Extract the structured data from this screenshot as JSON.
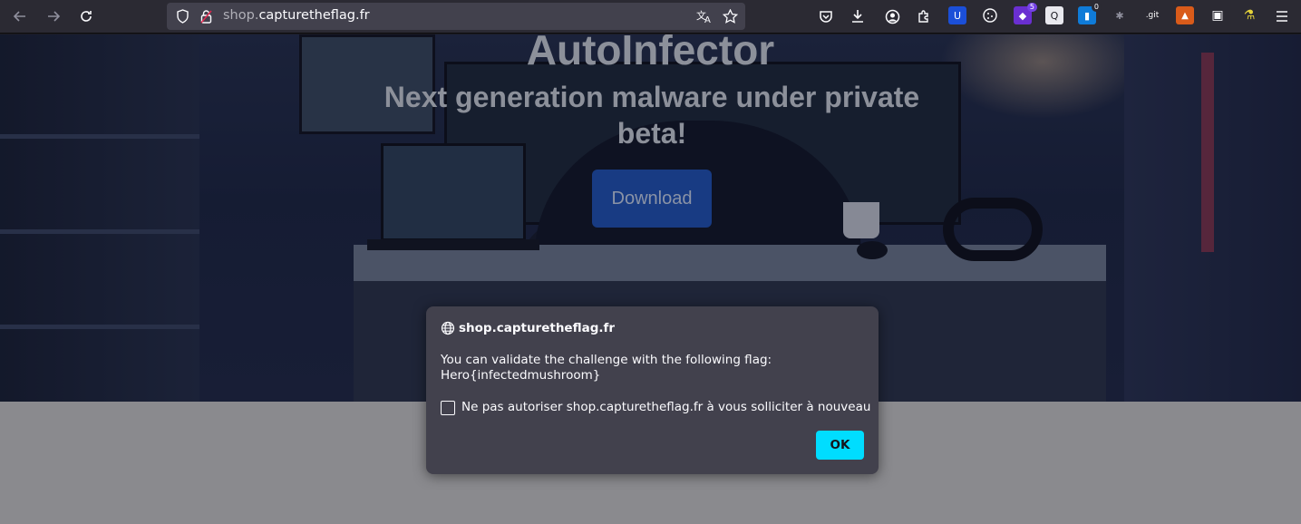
{
  "browser": {
    "url_subdomain": "shop.",
    "url_domain": "capturetheflag.fr",
    "icons": {
      "back": "arrow-left-icon",
      "forward": "arrow-right-icon",
      "reload": "reload-icon",
      "tracking": "shield-icon",
      "lock": "lock-icon",
      "translate": "translate-icon",
      "bookmark": "star-icon",
      "pocket": "pocket-icon",
      "downloads": "download-icon",
      "account": "account-icon",
      "extensions": "puzzle-icon",
      "menu": "hamburger-menu-icon"
    },
    "extensions": [
      {
        "name": "ublock-icon",
        "color": "#1b4fd8",
        "glyph": "U"
      },
      {
        "name": "cookie-icon",
        "color": "#2b2a33",
        "glyph": "◍"
      },
      {
        "name": "diamond-extension-icon",
        "color": "#6a2fd1",
        "glyph": "◆",
        "badge": "5"
      },
      {
        "name": "search-extension-icon",
        "color": "#e9e9ef",
        "glyph": "Q"
      },
      {
        "name": "blue-extension-icon",
        "color": "#0f7bd8",
        "glyph": "▮",
        "badge": "0"
      },
      {
        "name": "puzzle-gray-icon",
        "color": "#2b2a33",
        "glyph": "✱"
      },
      {
        "name": "git-extension-icon",
        "color": "#2b2a33",
        "glyph": ".git"
      },
      {
        "name": "fox-extension-icon",
        "color": "#2b2a33",
        "glyph": "🦊"
      },
      {
        "name": "card-extension-icon",
        "color": "#2b2a33",
        "glyph": "▣"
      },
      {
        "name": "flask-extension-icon",
        "color": "#2b2a33",
        "glyph": "⚗"
      }
    ]
  },
  "hero": {
    "title": "AutoInfector",
    "subtitle": "Next generation malware under private beta!",
    "download_label": "Download"
  },
  "dialog": {
    "origin": "shop.capturetheflag.fr",
    "message": "You can validate the challenge with the following flag:\nHero{infectedmushroom}",
    "checkbox_label": "Ne pas autoriser shop.capturetheflag.fr à vous solliciter à nouveau",
    "checkbox_checked": false,
    "ok_label": "OK"
  }
}
